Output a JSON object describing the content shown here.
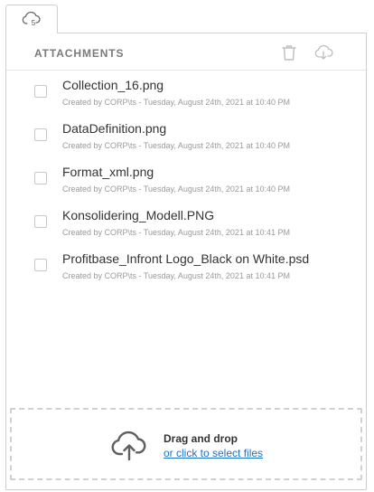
{
  "trigger": {
    "icon": "cloud-upload-icon",
    "count": "5"
  },
  "panel": {
    "title": "ATTACHMENTS",
    "actions": [
      {
        "icon": "trash-icon"
      },
      {
        "icon": "cloud-download-icon"
      }
    ]
  },
  "files": [
    {
      "name": "Collection_16.png",
      "meta": "Created by CORP\\ts - Tuesday, August 24th, 2021 at 10:40 PM",
      "checked": false
    },
    {
      "name": "DataDefinition.png",
      "meta": "Created by CORP\\ts - Tuesday, August 24th, 2021 at 10:40 PM",
      "checked": false
    },
    {
      "name": "Format_xml.png",
      "meta": "Created by CORP\\ts - Tuesday, August 24th, 2021 at 10:40 PM",
      "checked": false
    },
    {
      "name": "Konsolidering_Modell.PNG",
      "meta": "Created by CORP\\ts - Tuesday, August 24th, 2021 at 10:41 PM",
      "checked": false
    },
    {
      "name": "Profitbase_Infront Logo_Black on White.psd",
      "meta": "Created by CORP\\ts - Tuesday, August 24th, 2021 at 10:41 PM",
      "checked": false
    }
  ],
  "dropzone": {
    "icon": "cloud-upload-icon",
    "title": "Drag and drop",
    "link": "or click to select files"
  },
  "colors": {
    "link": "#1a73c8",
    "border": "#cfcfcf",
    "muted": "#9a9a9a"
  }
}
